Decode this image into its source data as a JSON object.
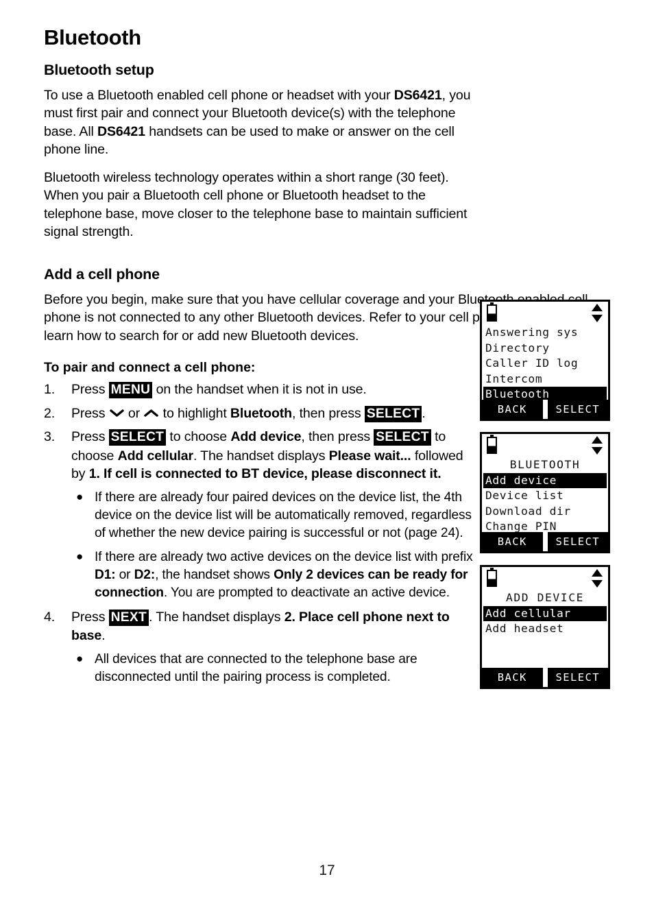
{
  "document": {
    "chapter_title": "Bluetooth",
    "page_number": "17"
  },
  "sections": {
    "bluetooth_setup": {
      "heading": "Bluetooth setup",
      "para1_a": "To use a Bluetooth enabled cell phone or headset with your ",
      "para1_model1": "DS6421",
      "para1_b": ", you must first pair and connect your Bluetooth device(s) with the telephone base. All ",
      "para1_model2": "DS6421",
      "para1_c": " handsets can be used to make or answer on the cell phone line.",
      "para2": "Bluetooth wireless technology operates within a short range (30 feet). When you pair a Bluetooth cell phone or Bluetooth headset to the telephone base, move closer to the telephone base to maintain sufficient signal strength."
    },
    "add_cell_phone": {
      "heading": "Add a cell phone",
      "intro": "Before you begin, make sure that you have cellular coverage and your Bluetooth enabled cell phone is not connected to any other Bluetooth devices. Refer to your cell phone user's manual to learn how to search for or add new Bluetooth devices.",
      "procedure_title": "To pair and connect a cell phone:"
    }
  },
  "steps": [
    {
      "num": "1.",
      "p1": "Press ",
      "key1": "MENU",
      "p2": " on the handset when it is not in use."
    },
    {
      "num": "2.",
      "p1": "Press ",
      "chev_down": "down-arrow",
      "p2": " or ",
      "chev_up": "up-arrow",
      "p3": " to highlight ",
      "bold1": "Bluetooth",
      "p4": ", then press ",
      "key1": "SELECT",
      "p5": "."
    },
    {
      "num": "3.",
      "p1": "Press ",
      "key1": "SELECT",
      "p2": " to choose ",
      "bold1": "Add device",
      "p3": ", then press ",
      "key2": "SELECT",
      "p4": " to choose ",
      "bold2": "Add cellular",
      "p5": ". The handset displays ",
      "bold3": "Please wait...",
      "p6": " followed by ",
      "bold4": "1. If cell is connected to BT device, please disconnect it.",
      "bullets": [
        "If there are already four paired devices on the device list, the 4th device on the device list will be automatically removed, regardless of whether the new device pairing is successful or not (page 24).",
        {
          "b1": "If there are already two active devices on the device list with prefix ",
          "bold1": "D1:",
          "b2": " or ",
          "bold2": "D2:",
          "b3": ", the handset shows ",
          "bold3": "Only 2 devices can be ready for connection",
          "b4": ". You are prompted to deactivate an active device."
        }
      ]
    },
    {
      "num": "4.",
      "p1": "Press ",
      "key1": "NEXT",
      "p2": ". The handset displays ",
      "bold1": "2. Place cell phone next to base",
      "p3": ".",
      "bullets": [
        "All devices that are connected to the telephone base are disconnected until the pairing process is completed."
      ]
    }
  ],
  "lcd_screens": [
    {
      "id": "menu-screen",
      "status": {
        "battery": "battery-icon",
        "scroll": "up-down-arrows-icon"
      },
      "title": null,
      "lines": [
        {
          "text": "Answering sys",
          "selected": false
        },
        {
          "text": "Directory",
          "selected": false
        },
        {
          "text": "Caller ID log",
          "selected": false
        },
        {
          "text": "Intercom",
          "selected": false
        },
        {
          "text": "Bluetooth",
          "selected": true
        }
      ],
      "softkeys": {
        "left": "BACK",
        "right": "SELECT"
      }
    },
    {
      "id": "bluetooth-menu-screen",
      "status": {
        "battery": "battery-icon",
        "scroll": "up-down-arrows-icon"
      },
      "title": "BLUETOOTH",
      "lines": [
        {
          "text": "Add device",
          "selected": true
        },
        {
          "text": "Device list",
          "selected": false
        },
        {
          "text": "Download dir",
          "selected": false
        },
        {
          "text": "Change PIN",
          "selected": false
        }
      ],
      "softkeys": {
        "left": "BACK",
        "right": "SELECT"
      }
    },
    {
      "id": "add-device-screen",
      "status": {
        "battery": "battery-icon",
        "scroll": "up-down-arrows-icon"
      },
      "title": "ADD DEVICE",
      "lines": [
        {
          "text": "Add cellular",
          "selected": true
        },
        {
          "text": "Add headset",
          "selected": false
        },
        {
          "text": "",
          "selected": false
        },
        {
          "text": "",
          "selected": false
        }
      ],
      "softkeys": {
        "left": "BACK",
        "right": "SELECT"
      }
    }
  ],
  "colors": {
    "ink": "#000000",
    "paper": "#ffffff",
    "page_number": "#1a1a1a"
  }
}
